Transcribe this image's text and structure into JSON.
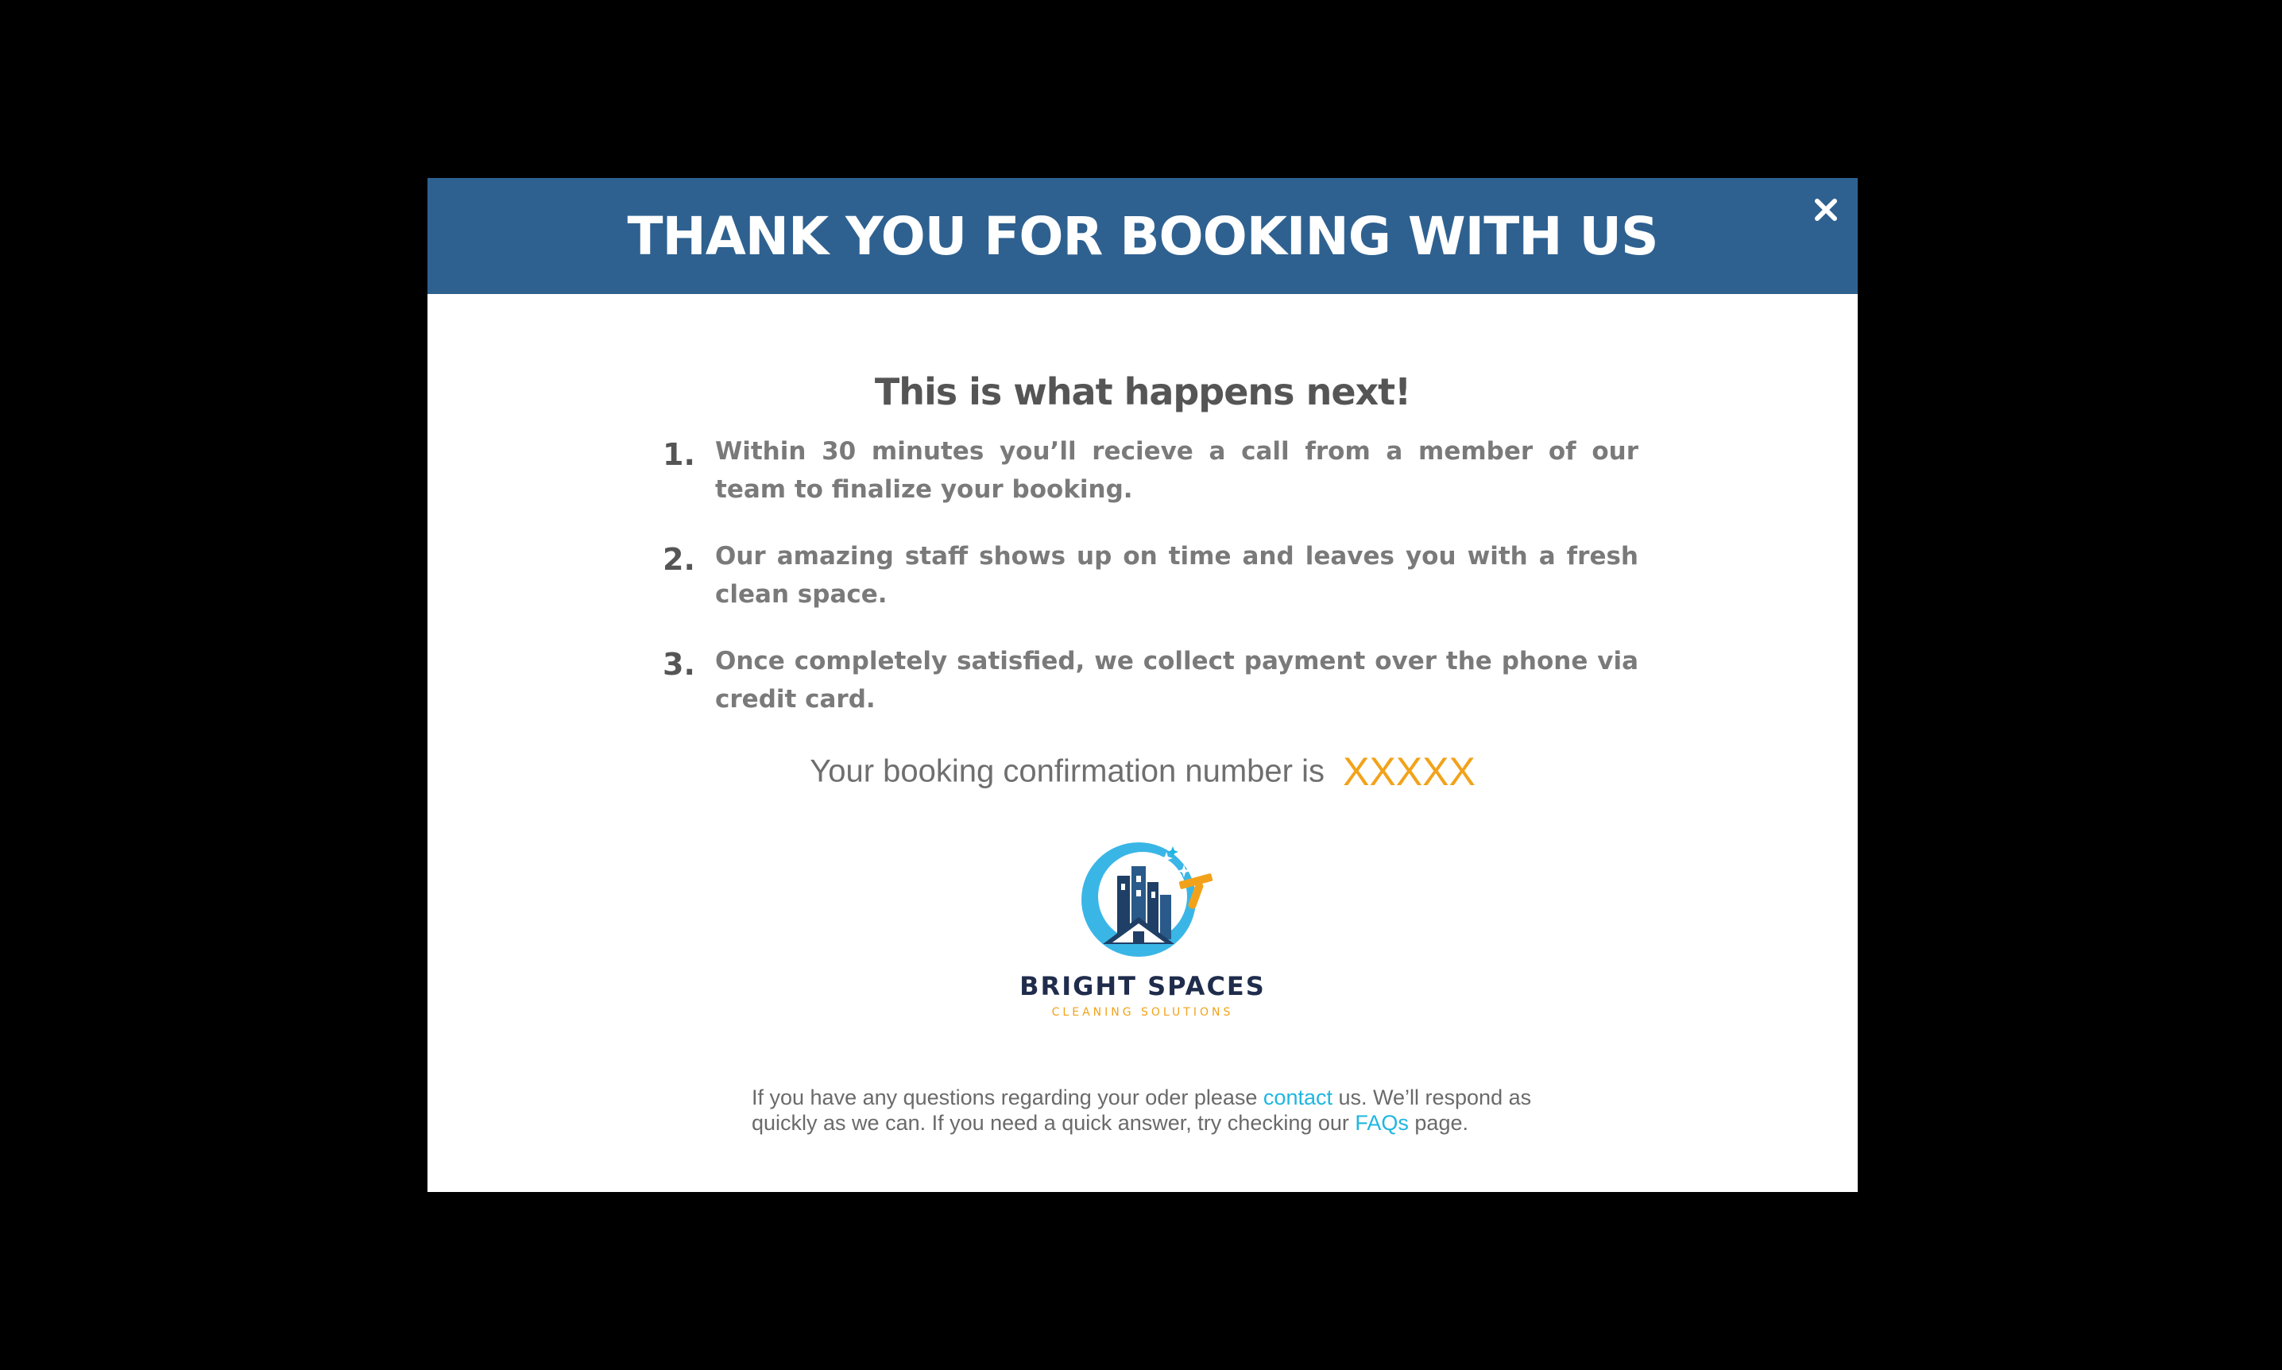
{
  "modal": {
    "title": "THANK YOU FOR BOOKING WITH US",
    "close_icon": "close-icon"
  },
  "next_steps": {
    "heading": "This is what happens next!",
    "items": [
      {
        "number": "1.",
        "text": "Within 30 minutes you’ll recieve a call from a member of our team to finalize your booking."
      },
      {
        "number": "2.",
        "text": "Our amazing staff shows up on time and leaves you with a fresh clean space."
      },
      {
        "number": "3.",
        "text": "Once completely satisfied, we collect payment over the phone via credit card."
      }
    ]
  },
  "confirmation": {
    "label": "Your booking confirmation number is",
    "number": "XXXXX"
  },
  "brand": {
    "name": "BRIGHT SPACES",
    "tagline": "CLEANING SOLUTIONS",
    "logo_icon": "building-squeegee-logo-icon"
  },
  "footer": {
    "part1": "If you have any questions regarding your oder please ",
    "contact_link": "contact",
    "part2": " us. We’ll respond as quickly as we can. If you need a quick answer, try checking our ",
    "faqs_link": "FAQs",
    "part3": " page."
  },
  "colors": {
    "header_bg": "#2e6190",
    "accent_orange": "#f2a21a",
    "link_blue": "#1fb6e0",
    "brand_navy": "#1f2c4c",
    "logo_sky": "#3ab6e6"
  }
}
